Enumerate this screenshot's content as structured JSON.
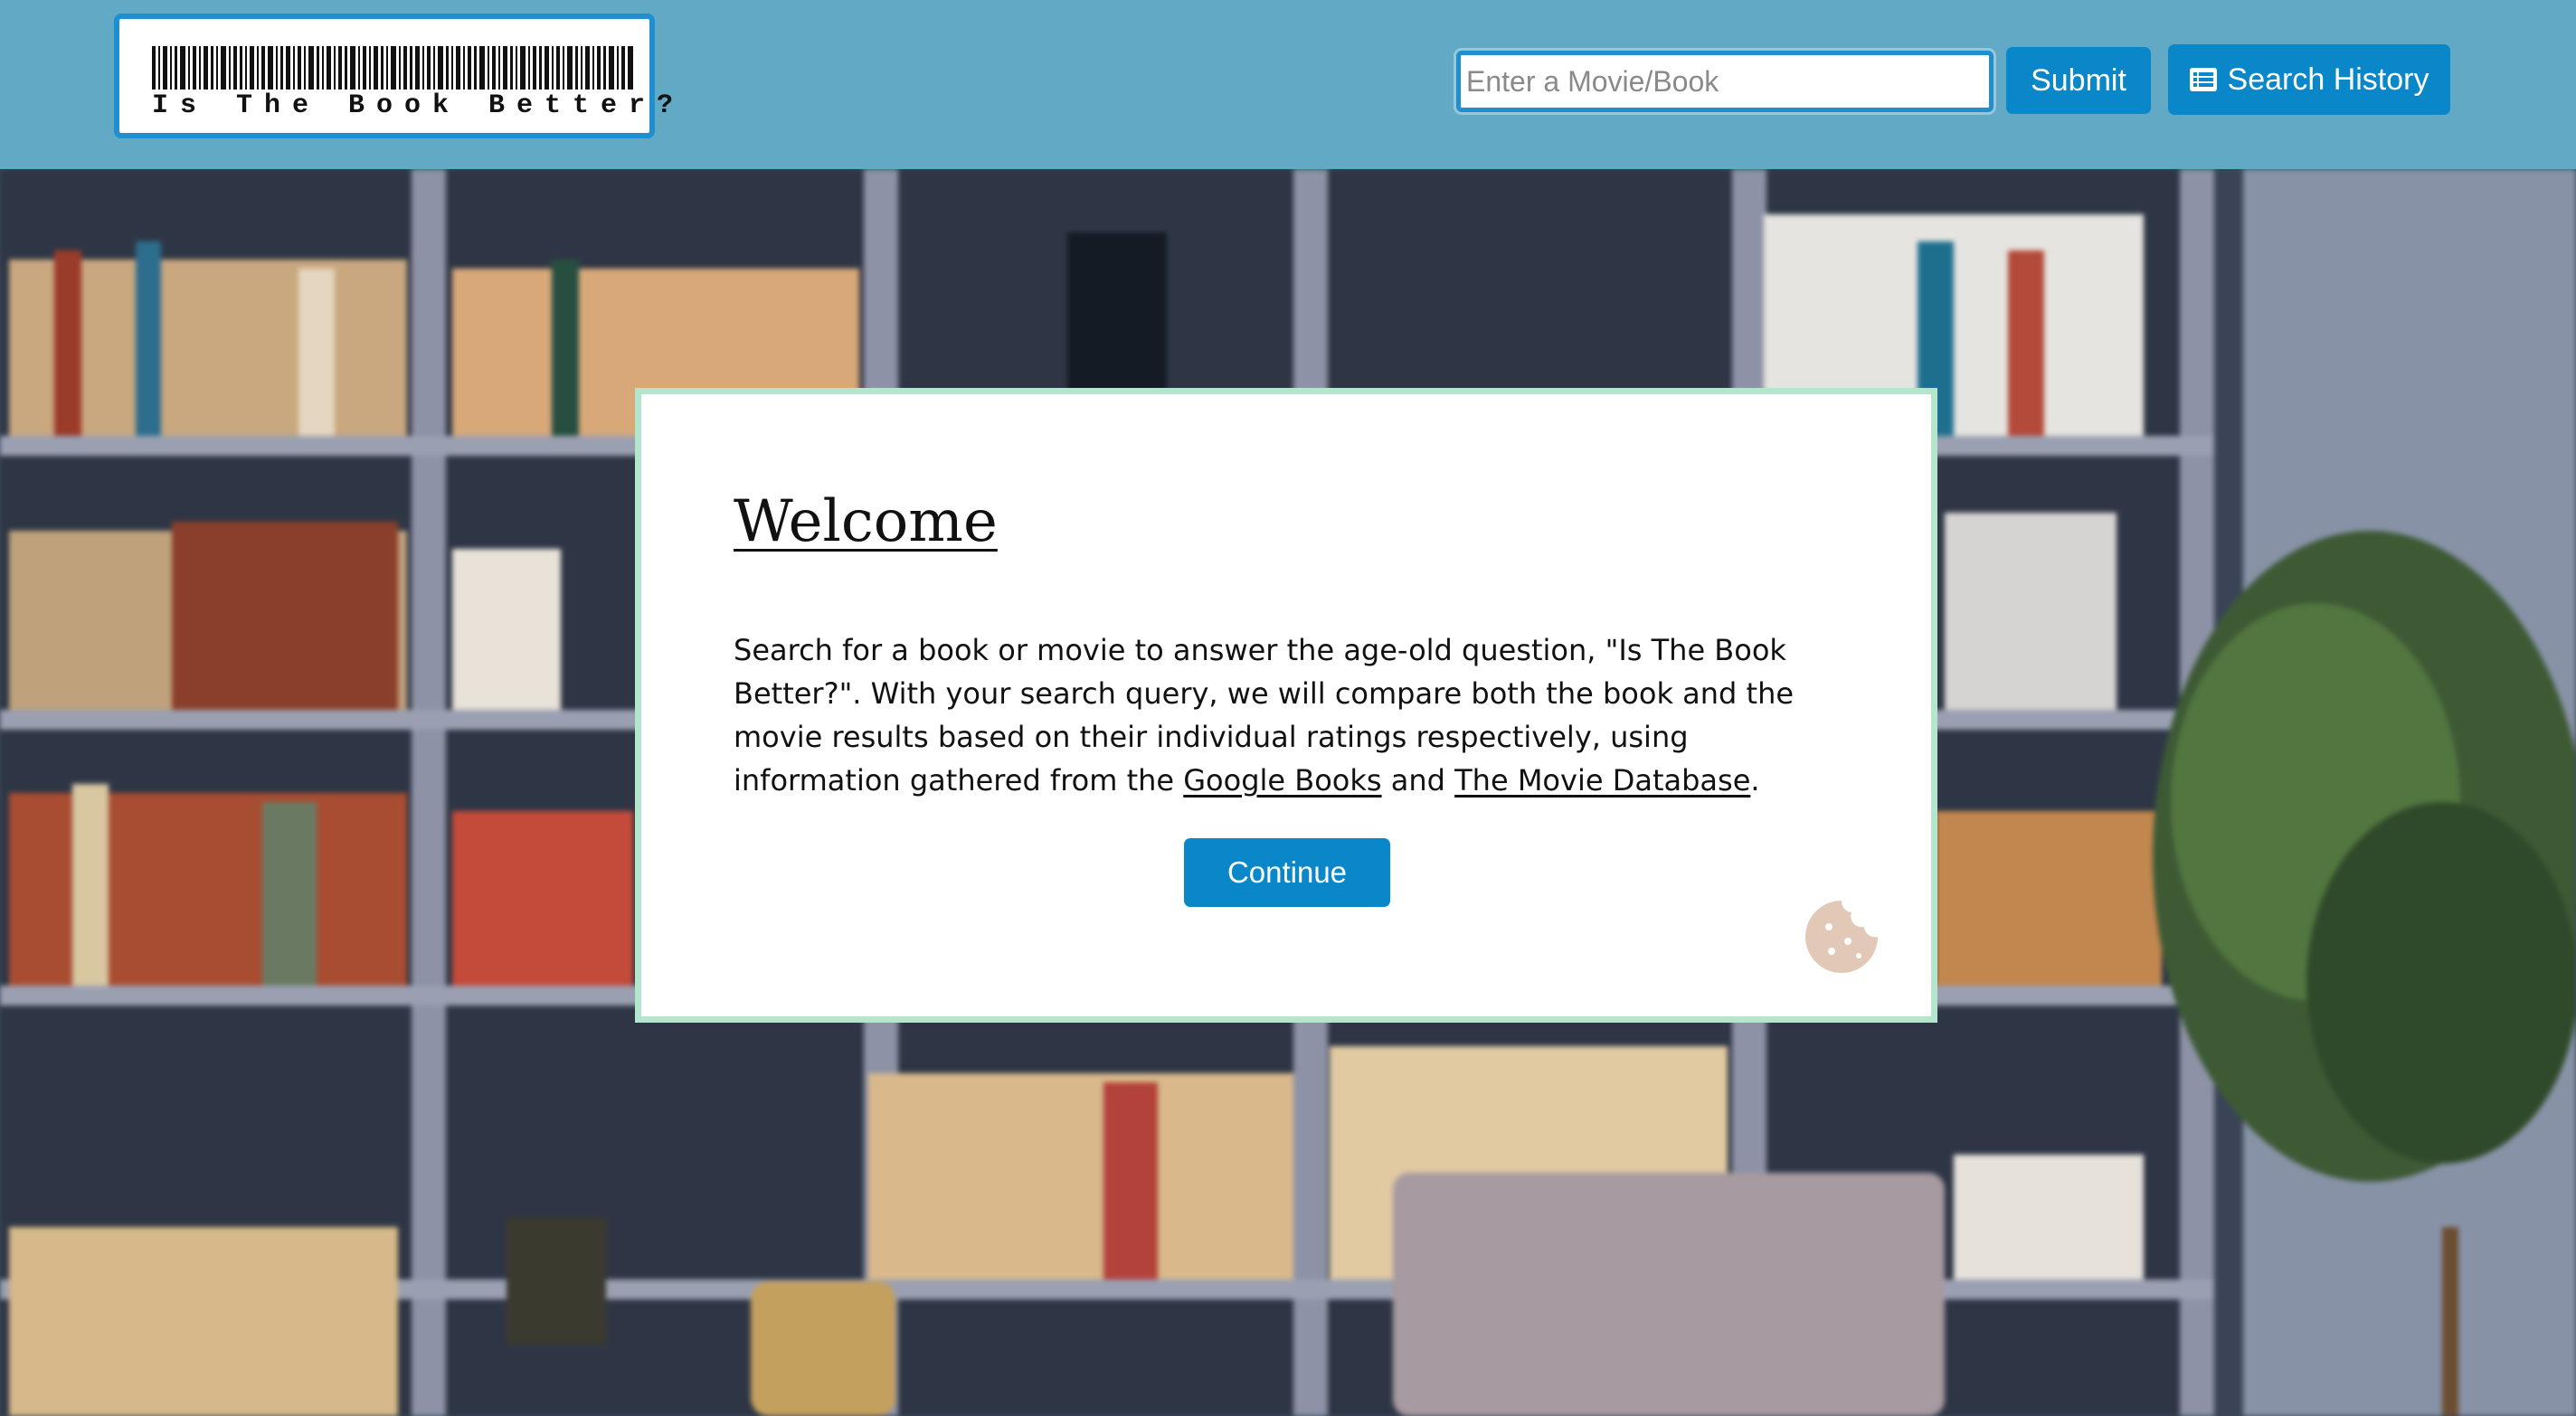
{
  "header": {
    "logo": {
      "text": "Is The Book Better?"
    },
    "search": {
      "placeholder": "Enter a Movie/Book",
      "value": ""
    },
    "submit_label": "Submit",
    "history": {
      "icon": "list-icon",
      "label": "Search History"
    }
  },
  "modal": {
    "title": "Welcome",
    "body": {
      "text_before": "Search for a book or movie to answer the age-old question, \"Is The Book Better?\". With your search query, we will compare both the book and the movie results based on their individual ratings respectively, using information gathered from the ",
      "link1": "Google Books",
      "text_middle": " and ",
      "link2": "The Movie Database",
      "text_after": "."
    },
    "continue_label": "Continue",
    "cookie_icon": "cookie-icon"
  },
  "colors": {
    "header_bg": "#61a9c5",
    "accent": "#0a87c9",
    "modal_border": "#b3e6cc",
    "cookie": "#e2c8b6"
  }
}
